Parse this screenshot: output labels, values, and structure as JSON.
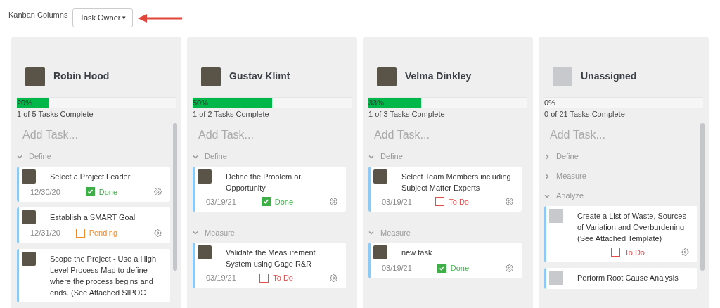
{
  "toolbar": {
    "label": "Kanban Columns",
    "dropdown": "Task Owner",
    "caret": "▾"
  },
  "columns": [
    {
      "owner": "Robin Hood",
      "has_photo": true,
      "progress": {
        "level": 0.2,
        "label": "20%"
      },
      "summary": "1 of 5 Tasks Complete",
      "add_task": {
        "placeholder": "Add Task..."
      },
      "scrollbar": true,
      "sections": [
        {
          "title": "Define",
          "expanded": true,
          "tasks": [
            {
              "title": "Select a Project Leader",
              "date": "12/30/20",
              "status": {
                "kind": "done",
                "label": "Done"
              }
            },
            {
              "title": "Establish a SMART Goal",
              "date": "12/31/20",
              "status": {
                "kind": "pending",
                "label": "Pending"
              }
            },
            {
              "title": "Scope the Project - Use a High Level Process Map to define where the process begins and ends. (See Attached SIPOC"
            }
          ]
        }
      ]
    },
    {
      "owner": "Gustav Klimt",
      "has_photo": true,
      "progress": {
        "level": 0.5,
        "label": "50%"
      },
      "summary": "1 of 2 Tasks Complete",
      "add_task": {
        "placeholder": "Add Task..."
      },
      "scrollbar": false,
      "sections": [
        {
          "title": "Define",
          "expanded": true,
          "tasks": [
            {
              "title": "Define the Problem or Opportunity",
              "date": "03/19/21",
              "status": {
                "kind": "done",
                "label": "Done"
              }
            }
          ]
        },
        {
          "title": "Measure",
          "expanded": true,
          "tasks": [
            {
              "title": "Validate the Measurement System using Gage R&R",
              "date": "03/19/21",
              "status": {
                "kind": "todo",
                "label": "To Do"
              }
            }
          ]
        }
      ]
    },
    {
      "owner": "Velma Dinkley",
      "has_photo": true,
      "progress": {
        "level": 0.33,
        "label": "33%"
      },
      "summary": "1 of 3 Tasks Complete",
      "add_task": {
        "placeholder": "Add Task..."
      },
      "scrollbar": false,
      "sections": [
        {
          "title": "Define",
          "expanded": true,
          "tasks": [
            {
              "title": "Select Team Members including Subject Matter Experts",
              "date": "03/19/21",
              "status": {
                "kind": "todo",
                "label": "To Do"
              }
            }
          ]
        },
        {
          "title": "Measure",
          "expanded": true,
          "tasks": [
            {
              "title": "new task",
              "date": "03/19/21",
              "status": {
                "kind": "done",
                "label": "Done"
              }
            }
          ]
        }
      ]
    },
    {
      "owner": "Unassigned",
      "has_photo": false,
      "progress": {
        "level": 0,
        "label": "0%"
      },
      "summary": "0 of 21 Tasks Complete",
      "add_task": {
        "placeholder": "Add Task..."
      },
      "scrollbar": true,
      "sections": [
        {
          "title": "Define",
          "expanded": false
        },
        {
          "title": "Measure",
          "expanded": false
        },
        {
          "title": "Analyze",
          "expanded": true,
          "tasks": [
            {
              "title": "Create a List of Waste, Sources of Variation and Overburdening (See Attached Template)",
              "status": {
                "kind": "todo",
                "label": "To Do"
              }
            },
            {
              "title": "Perform Root Cause Analysis"
            }
          ]
        }
      ]
    }
  ]
}
